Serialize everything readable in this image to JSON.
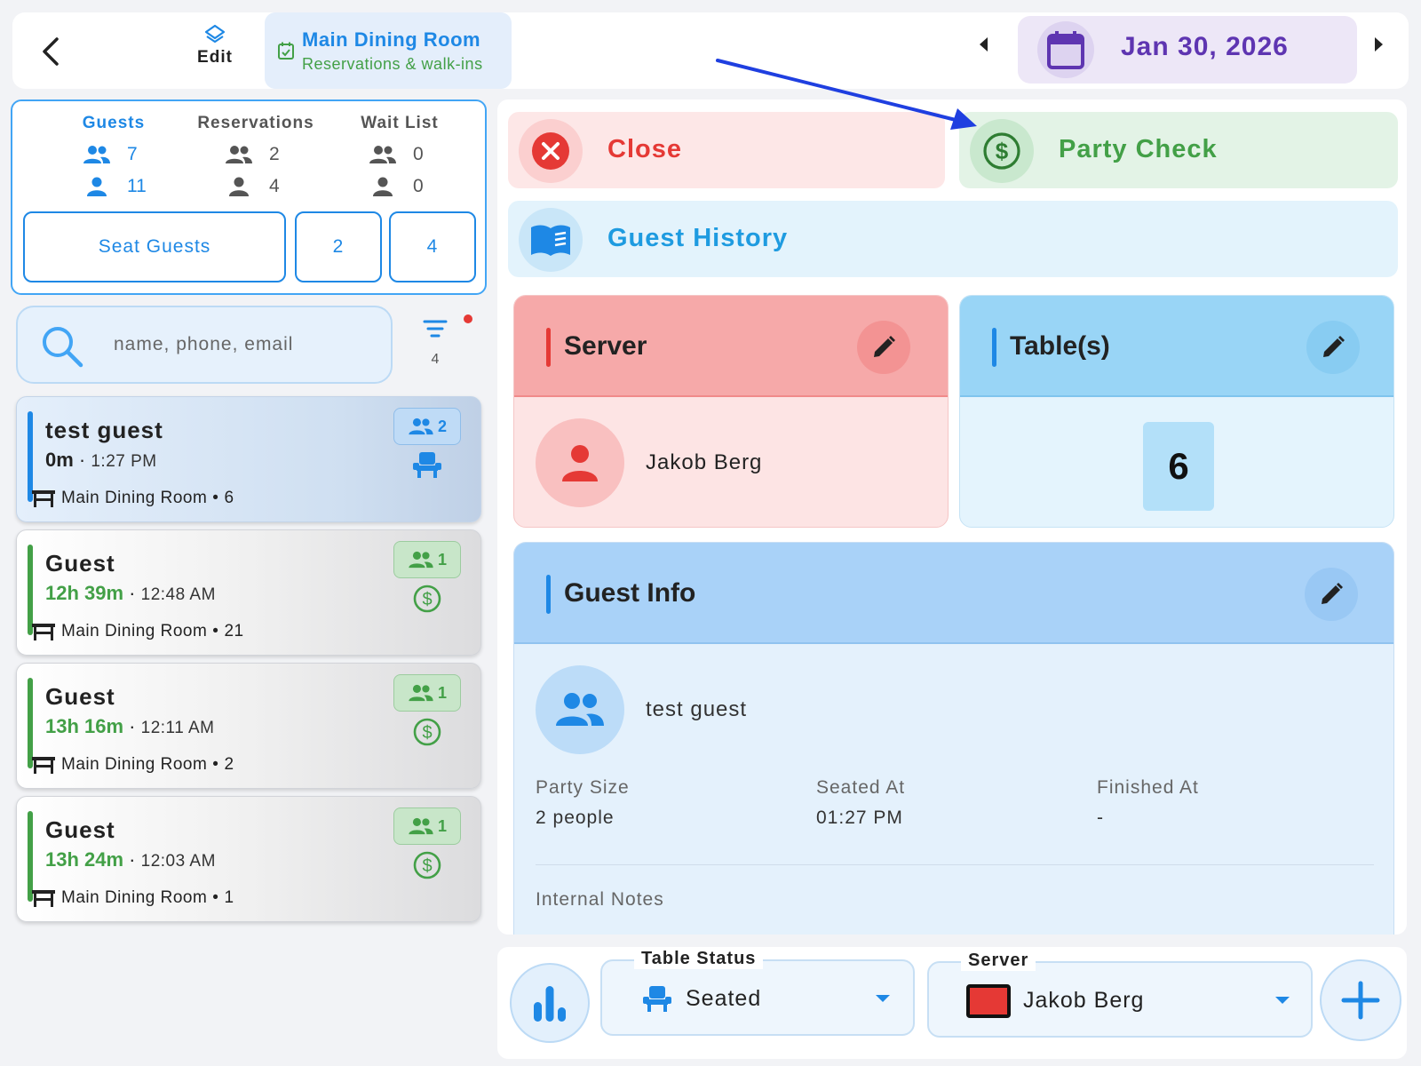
{
  "header": {
    "edit_label": "Edit",
    "room_title": "Main Dining Room",
    "room_subtitle": "Reservations & walk-ins",
    "date": "Jan 30, 2026"
  },
  "stats": {
    "guests": {
      "label": "Guests",
      "groups": "7",
      "people": "11"
    },
    "reservations": {
      "label": "Reservations",
      "groups": "2",
      "people": "4"
    },
    "waitlist": {
      "label": "Wait List",
      "groups": "0",
      "people": "0"
    },
    "buttons": {
      "seat": "Seat Guests",
      "count_a": "2",
      "count_b": "4"
    }
  },
  "search": {
    "placeholder": "name, phone, email",
    "filter_count": "4"
  },
  "guest_list": [
    {
      "name": "test guest",
      "duration": "0m",
      "clock": "1:27 PM",
      "room": "Main Dining Room",
      "table": "6",
      "party": "2",
      "status_icon": "seat-icon",
      "color": "#1e88e5"
    },
    {
      "name": "Guest",
      "duration": "12h 39m",
      "clock": "12:48 AM",
      "room": "Main Dining Room",
      "table": "21",
      "party": "1",
      "status_icon": "dollar-icon",
      "color": "#43a047"
    },
    {
      "name": "Guest",
      "duration": "13h 16m",
      "clock": "12:11 AM",
      "room": "Main Dining Room",
      "table": "2",
      "party": "1",
      "status_icon": "dollar-icon",
      "color": "#43a047"
    },
    {
      "name": "Guest",
      "duration": "13h 24m",
      "clock": "12:03 AM",
      "room": "Main Dining Room",
      "table": "1",
      "party": "1",
      "status_icon": "dollar-icon",
      "color": "#43a047"
    }
  ],
  "actions": {
    "close": "Close",
    "party_check": "Party Check",
    "guest_history": "Guest History"
  },
  "server_card": {
    "title": "Server",
    "name": "Jakob Berg"
  },
  "table_card": {
    "title": "Table(s)",
    "table": "6"
  },
  "guest_info": {
    "title": "Guest Info",
    "name": "test guest",
    "party_size_label": "Party Size",
    "party_size": "2 people",
    "seated_at_label": "Seated At",
    "seated_at": "01:27 PM",
    "finished_at_label": "Finished At",
    "finished_at": "-",
    "notes_label": "Internal Notes"
  },
  "bottom": {
    "table_status_label": "Table Status",
    "table_status": "Seated",
    "server_label": "Server",
    "server": "Jakob Berg",
    "server_color": "#e53935"
  },
  "colors": {
    "accent_blue": "#1e88e5",
    "green": "#43a047",
    "red": "#e53935",
    "purple": "#5e35b1"
  }
}
